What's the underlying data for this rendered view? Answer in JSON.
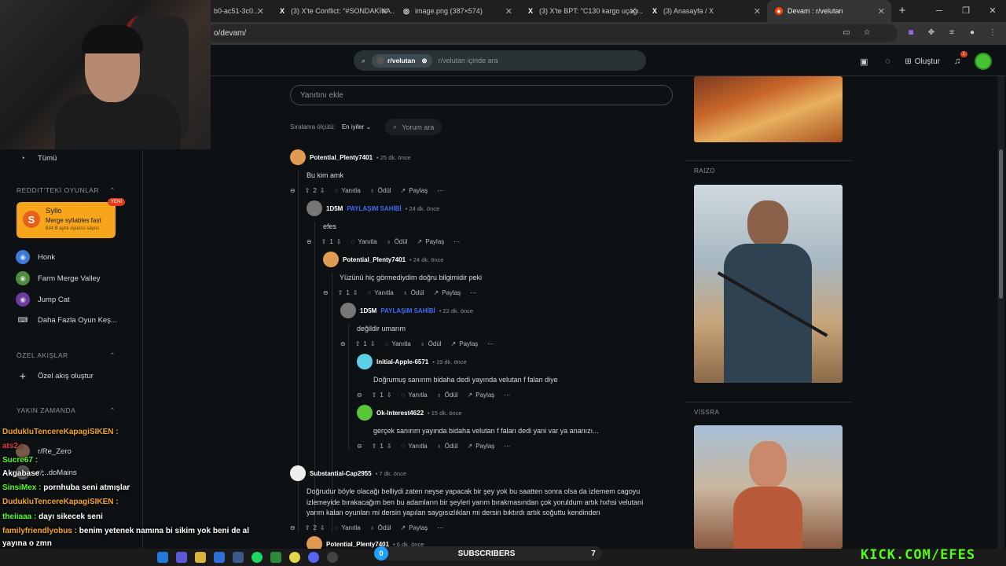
{
  "browser": {
    "tabs": [
      {
        "label": "b0-ac51-3c0..."
      },
      {
        "label": "(3) X'te Conflict: \"#SONDAKİKA..."
      },
      {
        "label": "image.png (387×574)"
      },
      {
        "label": "(3) X'te BPT: \"C130 kargo uçağı..."
      },
      {
        "label": "(3) Anasayfa / X"
      },
      {
        "label": "Devam : r/velutan"
      }
    ],
    "url": "o/devam/"
  },
  "header": {
    "subreddit_chip": "r/velutan",
    "search_placeholder": "r/velutan içinde ara",
    "create_label": "Oluştur",
    "notification_count": "1"
  },
  "sidebar": {
    "all_label": "Tümü",
    "games_section": "REDDIT'TEKİ OYUNLAR",
    "featured_game": {
      "title": "Syllo",
      "subtitle": "Merge syllables fast",
      "meta": "634 B aylık oyuncu sayısı",
      "badge": "YENİ"
    },
    "games": [
      "Honk",
      "Farm Merge Valley",
      "Jump Cat",
      "Daha Fazla Oyun Keş..."
    ],
    "custom_section": "ÖZEL AKIŞLAR",
    "custom_create": "Özel akış oluştur",
    "recent_section": "YAKIN ZAMANDA",
    "recent_items": [
      "r/Re_Zero",
      "r/...doMains"
    ]
  },
  "comments_ui": {
    "reply_placeholder": "Yanıtını ekle",
    "sort_label": "Sıralama ölçütü:",
    "sort_value": "En iyiler",
    "comment_search": "Yorum ara",
    "reply": "Yanıtla",
    "award": "Ödül",
    "share": "Paylaş"
  },
  "comments": [
    {
      "user": "Potential_Plenty7401",
      "op": "",
      "time": "25 dk. önce",
      "text": "Bu kim amk",
      "votes": "2"
    },
    {
      "user": "1D5M",
      "op": "PAYLAŞIM SAHİBİ",
      "time": "24 dk. önce",
      "text": "efes",
      "votes": "1"
    },
    {
      "user": "Potential_Plenty7401",
      "op": "",
      "time": "24 dk. önce",
      "text": "Yüzünü hiç görmediydim doğru bilgimidir peki",
      "votes": "1"
    },
    {
      "user": "1D5M",
      "op": "PAYLAŞIM SAHİBİ",
      "time": "22 dk. önce",
      "text": "değildir umarım",
      "votes": "1"
    },
    {
      "user": "Initial-Apple-6571",
      "op": "",
      "time": "19 dk. önce",
      "text": "Doğrumuş sanırım bidaha dedi yayında velutan f falan diye",
      "votes": "1"
    },
    {
      "user": "Ok-Interest4622",
      "op": "",
      "time": "15 dk. önce",
      "text": "gerçek sanırım yayında bidaha velutan f falan dedi yani var ya ananızı...",
      "votes": "1"
    },
    {
      "user": "Substantial-Cap2955",
      "op": "",
      "time": "7 dk. önce",
      "text": "Doğrudur böyle olacağı belliydi zaten neyse yapacak bir şey yok bu saatten sonra olsa da izlemem cagoyu izlemeyide bırakacağım ben bu adamların bir şeyleri yarım bırakmasından çok yoruldum artık hxhsi velutani yarım kalan oyunları mi dersin yapılan saygısızlıkları mi dersin bıktırdı artık soğuttu kendinden",
      "votes": "2"
    },
    {
      "user": "Potential_Plenty7401",
      "op": "",
      "time": "6 dk. önce",
      "text": "",
      "votes": ""
    }
  ],
  "right_cards": [
    {
      "name": "RAİZO"
    },
    {
      "name": "VİSSRA"
    }
  ],
  "chat": [
    {
      "user": "DudukluTencereKapagiSIKEN :",
      "msg": "",
      "color": "#f7a51b"
    },
    {
      "user": "ats2 :",
      "msg": "",
      "color": "#e13b3b"
    },
    {
      "user": "Sucre67 :",
      "msg": "",
      "color": "#53fc18"
    },
    {
      "user": "Akgabase :",
      "msg": "",
      "color": "#ffffff"
    },
    {
      "user": "SinsiMex :",
      "msg": "pornhuba seni atmışlar",
      "color": "#53fc18"
    },
    {
      "user": "DudukluTencereKapagiSIKEN :",
      "msg": "",
      "color": "#f7a51b"
    },
    {
      "user": "theiiaaa :",
      "msg": "dayı sikecek seni",
      "color": "#53fc18"
    },
    {
      "user": "familyfriendlyobus :",
      "msg": "benim yetenek namına bi sikim yok beni de al",
      "color": "#f7a51b"
    },
    {
      "user": "yayına o zmn",
      "msg": "",
      "color": "#ffffff"
    }
  ],
  "overlay": {
    "subs_count": "0",
    "subs_label": "SUBSCRIBERS",
    "subs_goal": "7",
    "kick_text": "KICK.COM/EFES"
  },
  "colors": {
    "accent": "#3d6cf0",
    "kick": "#53fc18",
    "bg": "#0e1113"
  }
}
